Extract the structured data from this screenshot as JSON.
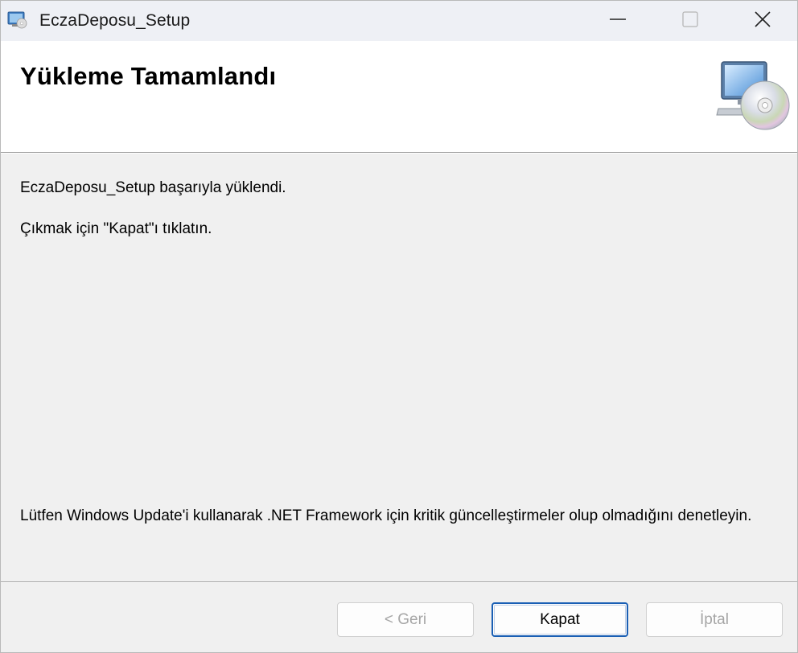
{
  "window": {
    "title": "EczaDeposu_Setup",
    "icon": "installer-app-icon",
    "controls": {
      "minimize": "minimize-icon",
      "maximize": "maximize-icon",
      "close": "close-icon"
    }
  },
  "banner": {
    "title": "Yükleme Tamamlandı",
    "art": "computer-with-cd-icon"
  },
  "body": {
    "message": "EczaDeposu_Setup başarıyla yüklendi.",
    "instruction": "Çıkmak için \"Kapat\"ı tıklatın.",
    "note": "Lütfen Windows Update'i kullanarak .NET Framework için kritik güncelleştirmeler olup olmadığını denetleyin."
  },
  "buttons": {
    "back": {
      "label": "< Geri",
      "enabled": false
    },
    "close": {
      "label": "Kapat",
      "enabled": true,
      "default": true
    },
    "cancel": {
      "label": "İptal",
      "enabled": false
    }
  },
  "colors": {
    "focus_border": "#1a5fb4",
    "disabled_text": "#a6a6a6",
    "banner_bg": "#ffffff",
    "dialog_bg": "#f0f0f0"
  }
}
